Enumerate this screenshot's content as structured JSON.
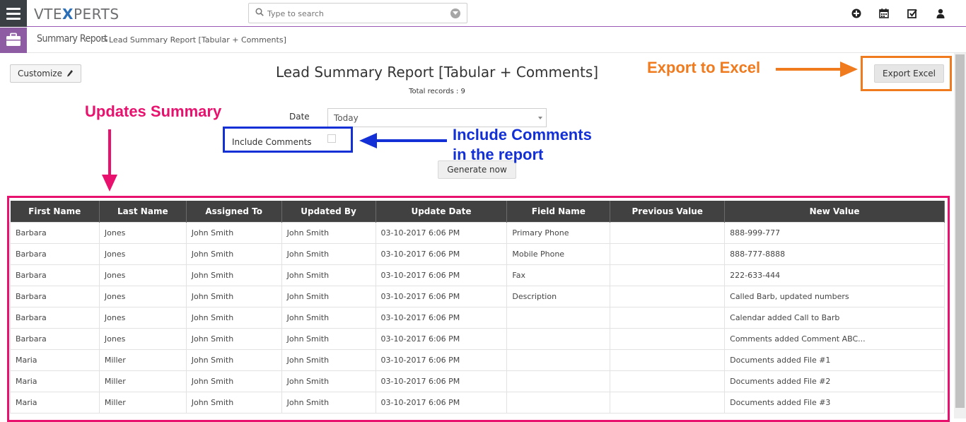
{
  "app": {
    "logo_left": "VTE",
    "logo_x": "X",
    "logo_right": "PERTS"
  },
  "search": {
    "placeholder": "Type to search"
  },
  "toolbar_icons": [
    "plus-circle-icon",
    "calendar-icon",
    "checkbox-icon",
    "user-icon"
  ],
  "breadcrumb": {
    "module": "Summary Report",
    "separator": ">",
    "current": "Lead Summary Report [Tabular + Comments]"
  },
  "report": {
    "customize_label": "Customize",
    "title": "Lead Summary Report [Tabular + Comments]",
    "total_records": "Total records : 9",
    "export_label": "Export Excel",
    "date_label": "Date",
    "date_value": "Today",
    "include_comments_label": "Include Comments",
    "include_comments_checked": false,
    "generate_label": "Generate now"
  },
  "annotations": {
    "export": "Export to Excel",
    "updates": "Updates Summary",
    "include_line1": "Include Comments",
    "include_line2": "in the report"
  },
  "colors": {
    "accent_purple": "#8e5ca3",
    "annotation_orange": "#f07a1e",
    "annotation_pink": "#e8126e",
    "annotation_blue": "#1230d6",
    "table_header": "#414141"
  },
  "table": {
    "columns": [
      "First Name",
      "Last Name",
      "Assigned To",
      "Updated By",
      "Update Date",
      "Field Name",
      "Previous Value",
      "New Value"
    ],
    "rows": [
      [
        "Barbara",
        "Jones",
        "John Smith",
        "John Smith",
        "03-10-2017 6:06 PM",
        "Primary Phone",
        "",
        "888-999-777"
      ],
      [
        "Barbara",
        "Jones",
        "John Smith",
        "John Smith",
        "03-10-2017 6:06 PM",
        "Mobile Phone",
        "",
        "888-777-8888"
      ],
      [
        "Barbara",
        "Jones",
        "John Smith",
        "John Smith",
        "03-10-2017 6:06 PM",
        "Fax",
        "",
        "222-633-444"
      ],
      [
        "Barbara",
        "Jones",
        "John Smith",
        "John Smith",
        "03-10-2017 6:06 PM",
        "Description",
        "",
        "Called Barb, updated numbers"
      ],
      [
        "Barbara",
        "Jones",
        "John Smith",
        "John Smith",
        "03-10-2017 6:06 PM",
        "",
        "",
        "Calendar added  Call to Barb"
      ],
      [
        "Barbara",
        "Jones",
        "John Smith",
        "John Smith",
        "03-10-2017 6:06 PM",
        "",
        "",
        "Comments added Comment ABC..."
      ],
      [
        "Maria",
        "Miller",
        "John Smith",
        "John Smith",
        "03-10-2017 6:06 PM",
        "",
        "",
        "Documents added File #1"
      ],
      [
        "Maria",
        "Miller",
        "John Smith",
        "John Smith",
        "03-10-2017 6:06 PM",
        "",
        "",
        "Documents added File #2"
      ],
      [
        "Maria",
        "Miller",
        "John Smith",
        "John Smith",
        "03-10-2017 6:06 PM",
        "",
        "",
        "Documents added File #3"
      ]
    ]
  }
}
